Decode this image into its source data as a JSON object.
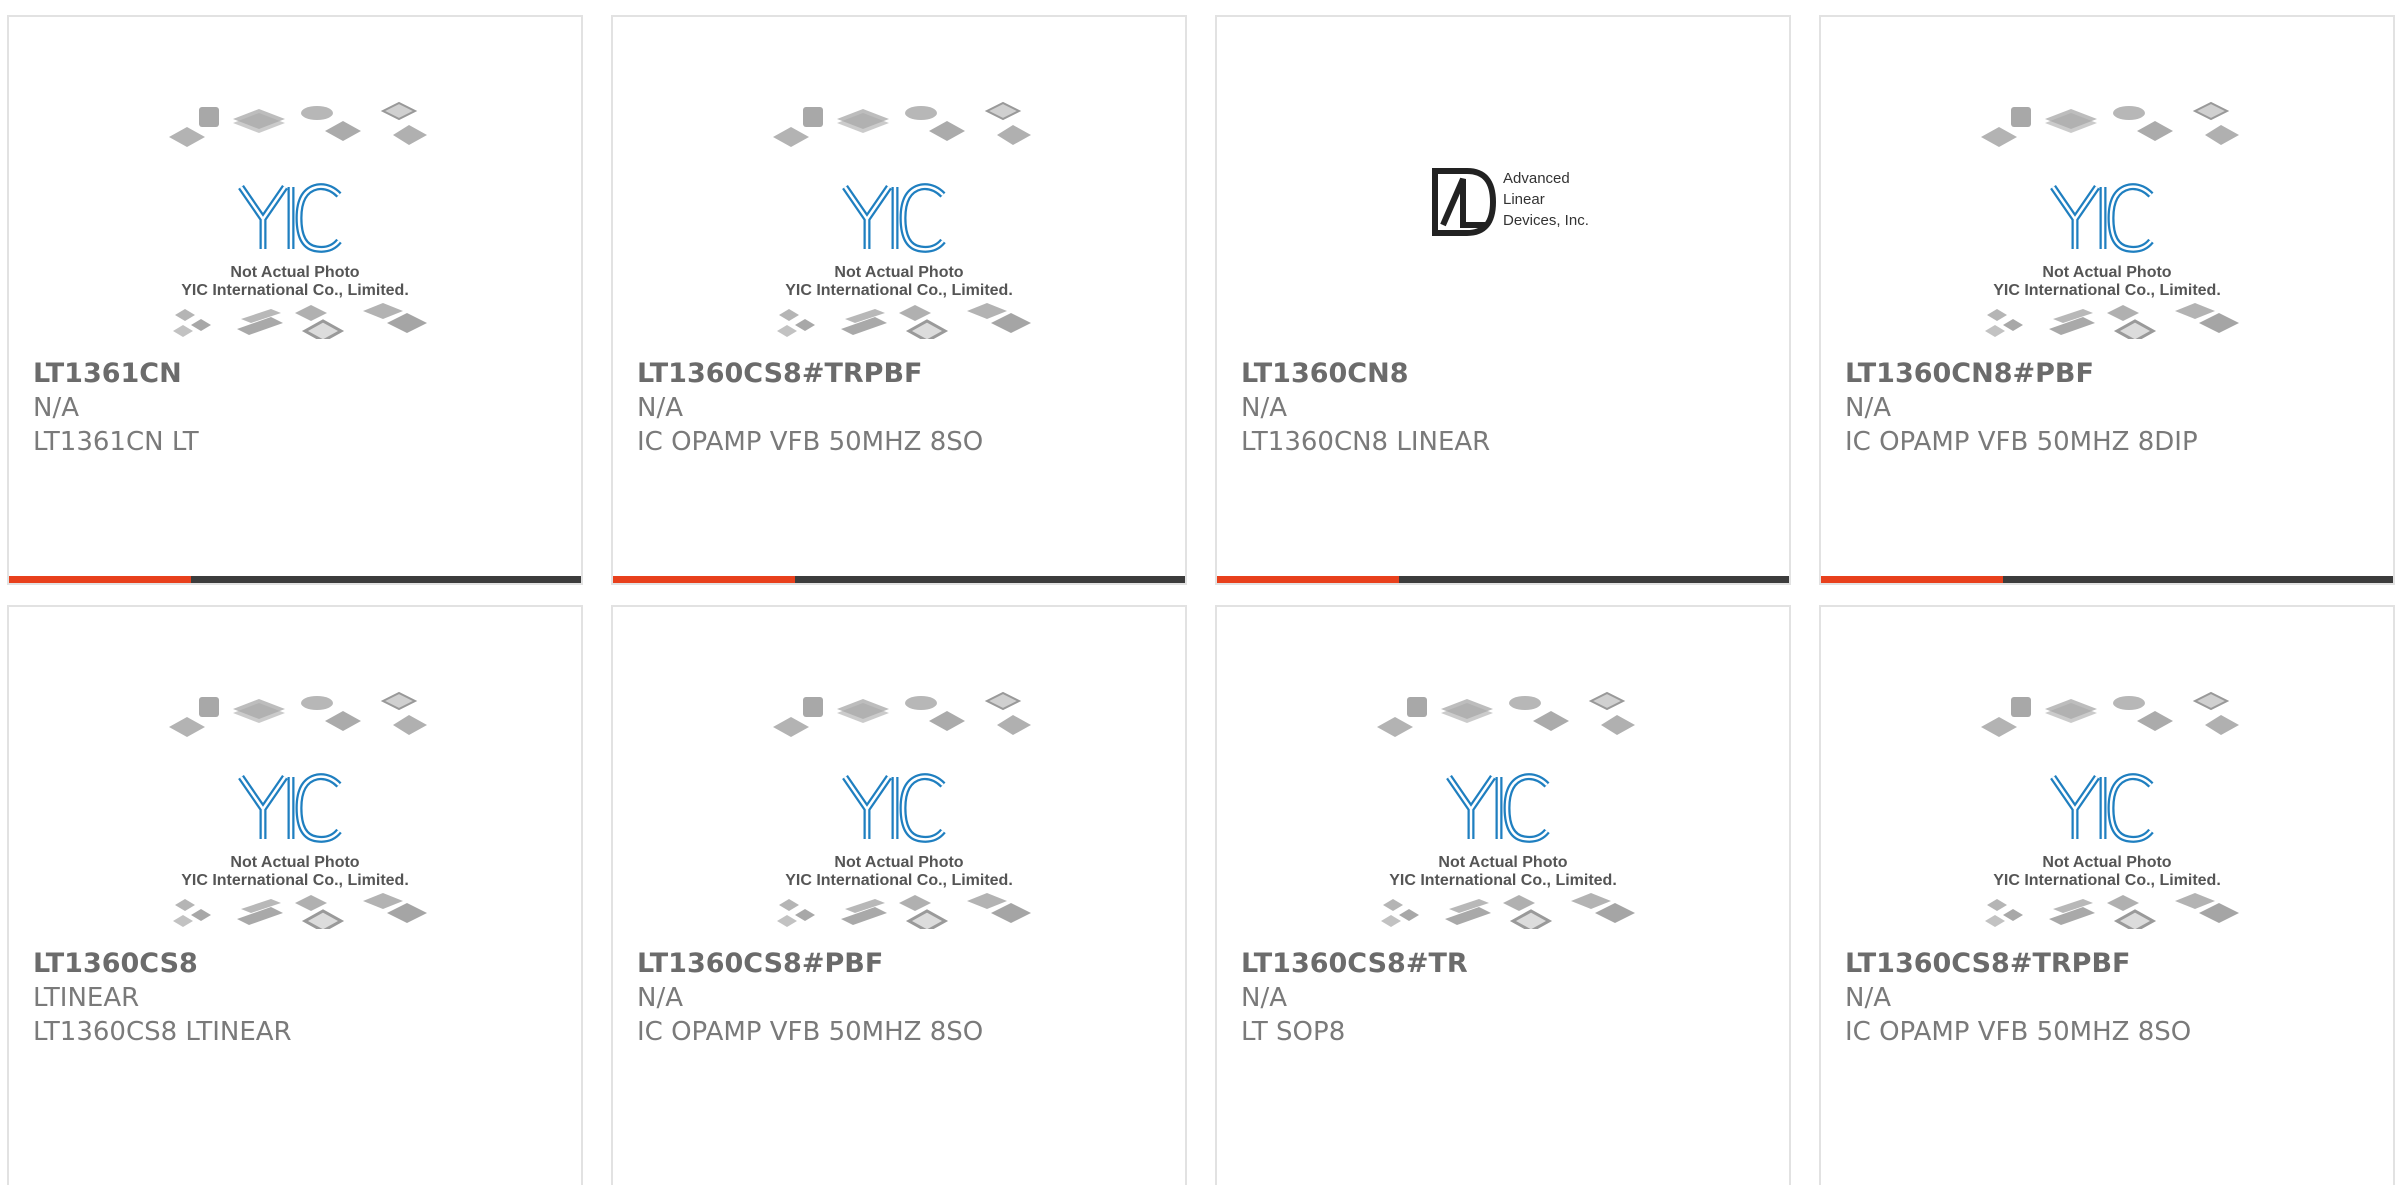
{
  "theme": {
    "accent": "#e8401c",
    "bar": "#3c3c3c",
    "logo_blue": "#1f7fc0"
  },
  "yic_logo": {
    "line1": "Not Actual Photo",
    "line2": "YIC International Co., Limited.",
    "mark": "YIC"
  },
  "ald_logo": {
    "line1": "Advanced",
    "line2": "Linear",
    "line3": "Devices, Inc."
  },
  "products": [
    {
      "name": "LT1361CN",
      "manufacturer": "N/A",
      "description": "LT1361CN LT",
      "image": "yic-placeholder"
    },
    {
      "name": "LT1360CS8#TRPBF",
      "manufacturer": "N/A",
      "description": "IC OPAMP VFB 50MHZ 8SO",
      "image": "yic-placeholder"
    },
    {
      "name": "LT1360CN8",
      "manufacturer": "N/A",
      "description": "LT1360CN8 LINEAR",
      "image": "ald-logo"
    },
    {
      "name": "LT1360CN8#PBF",
      "manufacturer": "N/A",
      "description": "IC OPAMP VFB 50MHZ 8DIP",
      "image": "yic-placeholder"
    },
    {
      "name": "LT1360CS8",
      "manufacturer": "LTINEAR",
      "description": "LT1360CS8 LTINEAR",
      "image": "yic-placeholder"
    },
    {
      "name": "LT1360CS8#PBF",
      "manufacturer": "N/A",
      "description": "IC OPAMP VFB 50MHZ 8SO",
      "image": "yic-placeholder"
    },
    {
      "name": "LT1360CS8#TR",
      "manufacturer": "N/A",
      "description": "LT SOP8",
      "image": "yic-placeholder"
    },
    {
      "name": "LT1360CS8#TRPBF",
      "manufacturer": "N/A",
      "description": "IC OPAMP VFB 50MHZ 8SO",
      "image": "yic-placeholder"
    }
  ]
}
